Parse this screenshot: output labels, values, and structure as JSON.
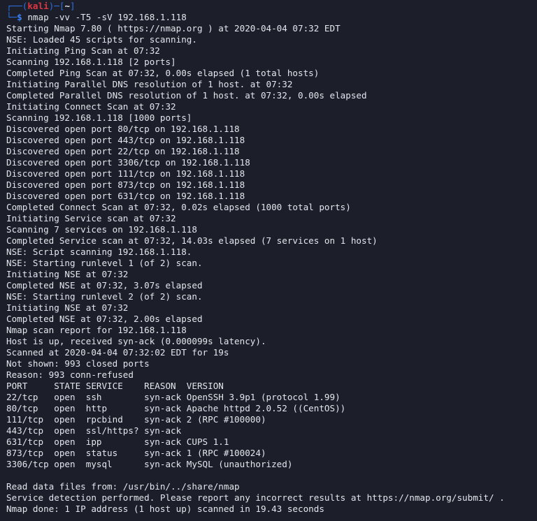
{
  "prompt": {
    "user": "kali",
    "dir": "~",
    "command": "nmap -vv -T5 -sV 192.168.1.118"
  },
  "output_lines": [
    "Starting Nmap 7.80 ( https://nmap.org ) at 2020-04-04 07:32 EDT",
    "NSE: Loaded 45 scripts for scanning.",
    "Initiating Ping Scan at 07:32",
    "Scanning 192.168.1.118 [2 ports]",
    "Completed Ping Scan at 07:32, 0.00s elapsed (1 total hosts)",
    "Initiating Parallel DNS resolution of 1 host. at 07:32",
    "Completed Parallel DNS resolution of 1 host. at 07:32, 0.00s elapsed",
    "Initiating Connect Scan at 07:32",
    "Scanning 192.168.1.118 [1000 ports]",
    "Discovered open port 80/tcp on 192.168.1.118",
    "Discovered open port 443/tcp on 192.168.1.118",
    "Discovered open port 22/tcp on 192.168.1.118",
    "Discovered open port 3306/tcp on 192.168.1.118",
    "Discovered open port 111/tcp on 192.168.1.118",
    "Discovered open port 873/tcp on 192.168.1.118",
    "Discovered open port 631/tcp on 192.168.1.118",
    "Completed Connect Scan at 07:32, 0.02s elapsed (1000 total ports)",
    "Initiating Service scan at 07:32",
    "Scanning 7 services on 192.168.1.118",
    "Completed Service scan at 07:32, 14.03s elapsed (7 services on 1 host)",
    "NSE: Script scanning 192.168.1.118.",
    "NSE: Starting runlevel 1 (of 2) scan.",
    "Initiating NSE at 07:32",
    "Completed NSE at 07:32, 3.07s elapsed",
    "NSE: Starting runlevel 2 (of 2) scan.",
    "Initiating NSE at 07:32",
    "Completed NSE at 07:32, 2.00s elapsed",
    "Nmap scan report for 192.168.1.118",
    "Host is up, received syn-ack (0.000099s latency).",
    "Scanned at 2020-04-04 07:32:02 EDT for 19s",
    "Not shown: 993 closed ports",
    "Reason: 993 conn-refused"
  ],
  "port_table": {
    "header": "PORT     STATE SERVICE    REASON  VERSION",
    "rows": [
      "22/tcp   open  ssh        syn-ack OpenSSH 3.9p1 (protocol 1.99)",
      "80/tcp   open  http       syn-ack Apache httpd 2.0.52 ((CentOS))",
      "111/tcp  open  rpcbind    syn-ack 2 (RPC #100000)",
      "443/tcp  open  ssl/https? syn-ack",
      "631/tcp  open  ipp        syn-ack CUPS 1.1",
      "873/tcp  open  status     syn-ack 1 (RPC #100024)",
      "3306/tcp open  mysql      syn-ack MySQL (unauthorized)"
    ]
  },
  "footer_lines": [
    "Read data files from: /usr/bin/../share/nmap",
    "Service detection performed. Please report any incorrect results at https://nmap.org/submit/ .",
    "Nmap done: 1 IP address (1 host up) scanned in 19.43 seconds"
  ]
}
